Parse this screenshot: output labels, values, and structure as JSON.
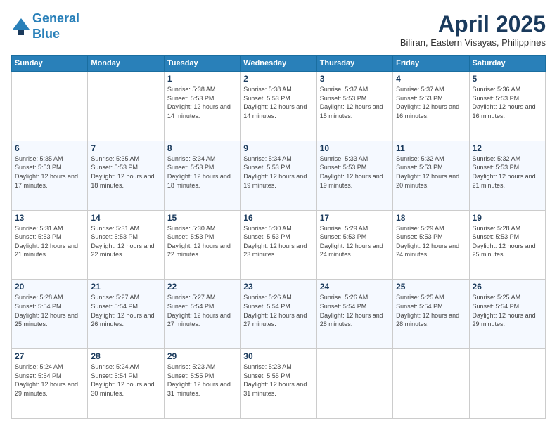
{
  "header": {
    "logo_line1": "General",
    "logo_line2": "Blue",
    "month_year": "April 2025",
    "location": "Biliran, Eastern Visayas, Philippines"
  },
  "weekdays": [
    "Sunday",
    "Monday",
    "Tuesday",
    "Wednesday",
    "Thursday",
    "Friday",
    "Saturday"
  ],
  "weeks": [
    [
      {
        "day": "",
        "sunrise": "",
        "sunset": "",
        "daylight": ""
      },
      {
        "day": "",
        "sunrise": "",
        "sunset": "",
        "daylight": ""
      },
      {
        "day": "1",
        "sunrise": "Sunrise: 5:38 AM",
        "sunset": "Sunset: 5:53 PM",
        "daylight": "Daylight: 12 hours and 14 minutes."
      },
      {
        "day": "2",
        "sunrise": "Sunrise: 5:38 AM",
        "sunset": "Sunset: 5:53 PM",
        "daylight": "Daylight: 12 hours and 14 minutes."
      },
      {
        "day": "3",
        "sunrise": "Sunrise: 5:37 AM",
        "sunset": "Sunset: 5:53 PM",
        "daylight": "Daylight: 12 hours and 15 minutes."
      },
      {
        "day": "4",
        "sunrise": "Sunrise: 5:37 AM",
        "sunset": "Sunset: 5:53 PM",
        "daylight": "Daylight: 12 hours and 16 minutes."
      },
      {
        "day": "5",
        "sunrise": "Sunrise: 5:36 AM",
        "sunset": "Sunset: 5:53 PM",
        "daylight": "Daylight: 12 hours and 16 minutes."
      }
    ],
    [
      {
        "day": "6",
        "sunrise": "Sunrise: 5:35 AM",
        "sunset": "Sunset: 5:53 PM",
        "daylight": "Daylight: 12 hours and 17 minutes."
      },
      {
        "day": "7",
        "sunrise": "Sunrise: 5:35 AM",
        "sunset": "Sunset: 5:53 PM",
        "daylight": "Daylight: 12 hours and 18 minutes."
      },
      {
        "day": "8",
        "sunrise": "Sunrise: 5:34 AM",
        "sunset": "Sunset: 5:53 PM",
        "daylight": "Daylight: 12 hours and 18 minutes."
      },
      {
        "day": "9",
        "sunrise": "Sunrise: 5:34 AM",
        "sunset": "Sunset: 5:53 PM",
        "daylight": "Daylight: 12 hours and 19 minutes."
      },
      {
        "day": "10",
        "sunrise": "Sunrise: 5:33 AM",
        "sunset": "Sunset: 5:53 PM",
        "daylight": "Daylight: 12 hours and 19 minutes."
      },
      {
        "day": "11",
        "sunrise": "Sunrise: 5:32 AM",
        "sunset": "Sunset: 5:53 PM",
        "daylight": "Daylight: 12 hours and 20 minutes."
      },
      {
        "day": "12",
        "sunrise": "Sunrise: 5:32 AM",
        "sunset": "Sunset: 5:53 PM",
        "daylight": "Daylight: 12 hours and 21 minutes."
      }
    ],
    [
      {
        "day": "13",
        "sunrise": "Sunrise: 5:31 AM",
        "sunset": "Sunset: 5:53 PM",
        "daylight": "Daylight: 12 hours and 21 minutes."
      },
      {
        "day": "14",
        "sunrise": "Sunrise: 5:31 AM",
        "sunset": "Sunset: 5:53 PM",
        "daylight": "Daylight: 12 hours and 22 minutes."
      },
      {
        "day": "15",
        "sunrise": "Sunrise: 5:30 AM",
        "sunset": "Sunset: 5:53 PM",
        "daylight": "Daylight: 12 hours and 22 minutes."
      },
      {
        "day": "16",
        "sunrise": "Sunrise: 5:30 AM",
        "sunset": "Sunset: 5:53 PM",
        "daylight": "Daylight: 12 hours and 23 minutes."
      },
      {
        "day": "17",
        "sunrise": "Sunrise: 5:29 AM",
        "sunset": "Sunset: 5:53 PM",
        "daylight": "Daylight: 12 hours and 24 minutes."
      },
      {
        "day": "18",
        "sunrise": "Sunrise: 5:29 AM",
        "sunset": "Sunset: 5:53 PM",
        "daylight": "Daylight: 12 hours and 24 minutes."
      },
      {
        "day": "19",
        "sunrise": "Sunrise: 5:28 AM",
        "sunset": "Sunset: 5:53 PM",
        "daylight": "Daylight: 12 hours and 25 minutes."
      }
    ],
    [
      {
        "day": "20",
        "sunrise": "Sunrise: 5:28 AM",
        "sunset": "Sunset: 5:54 PM",
        "daylight": "Daylight: 12 hours and 25 minutes."
      },
      {
        "day": "21",
        "sunrise": "Sunrise: 5:27 AM",
        "sunset": "Sunset: 5:54 PM",
        "daylight": "Daylight: 12 hours and 26 minutes."
      },
      {
        "day": "22",
        "sunrise": "Sunrise: 5:27 AM",
        "sunset": "Sunset: 5:54 PM",
        "daylight": "Daylight: 12 hours and 27 minutes."
      },
      {
        "day": "23",
        "sunrise": "Sunrise: 5:26 AM",
        "sunset": "Sunset: 5:54 PM",
        "daylight": "Daylight: 12 hours and 27 minutes."
      },
      {
        "day": "24",
        "sunrise": "Sunrise: 5:26 AM",
        "sunset": "Sunset: 5:54 PM",
        "daylight": "Daylight: 12 hours and 28 minutes."
      },
      {
        "day": "25",
        "sunrise": "Sunrise: 5:25 AM",
        "sunset": "Sunset: 5:54 PM",
        "daylight": "Daylight: 12 hours and 28 minutes."
      },
      {
        "day": "26",
        "sunrise": "Sunrise: 5:25 AM",
        "sunset": "Sunset: 5:54 PM",
        "daylight": "Daylight: 12 hours and 29 minutes."
      }
    ],
    [
      {
        "day": "27",
        "sunrise": "Sunrise: 5:24 AM",
        "sunset": "Sunset: 5:54 PM",
        "daylight": "Daylight: 12 hours and 29 minutes."
      },
      {
        "day": "28",
        "sunrise": "Sunrise: 5:24 AM",
        "sunset": "Sunset: 5:54 PM",
        "daylight": "Daylight: 12 hours and 30 minutes."
      },
      {
        "day": "29",
        "sunrise": "Sunrise: 5:23 AM",
        "sunset": "Sunset: 5:55 PM",
        "daylight": "Daylight: 12 hours and 31 minutes."
      },
      {
        "day": "30",
        "sunrise": "Sunrise: 5:23 AM",
        "sunset": "Sunset: 5:55 PM",
        "daylight": "Daylight: 12 hours and 31 minutes."
      },
      {
        "day": "",
        "sunrise": "",
        "sunset": "",
        "daylight": ""
      },
      {
        "day": "",
        "sunrise": "",
        "sunset": "",
        "daylight": ""
      },
      {
        "day": "",
        "sunrise": "",
        "sunset": "",
        "daylight": ""
      }
    ]
  ]
}
